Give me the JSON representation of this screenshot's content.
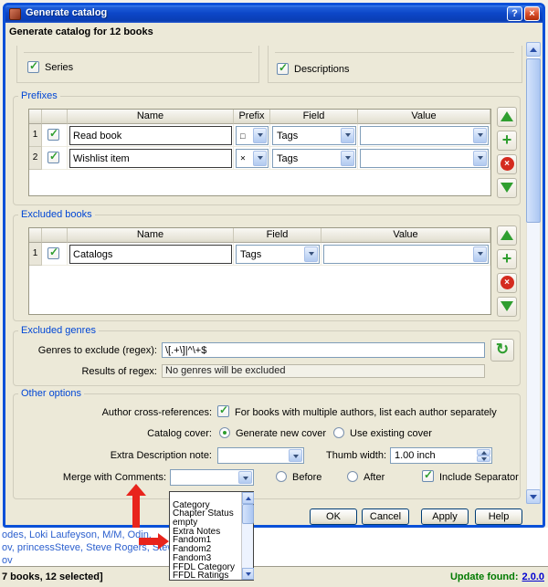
{
  "window": {
    "title": "Generate catalog"
  },
  "icons": {
    "help": "?",
    "close": "×",
    "check": "✓",
    "plus": "+",
    "delete": "×",
    "refresh": "↻"
  },
  "header": {
    "title": "Generate catalog for 12 books"
  },
  "scrolled_top": {
    "series": "Series",
    "descriptions": "Descriptions"
  },
  "prefixes": {
    "title": "Prefixes",
    "headers": {
      "name": "Name",
      "prefix": "Prefix",
      "field": "Field",
      "value": "Value"
    },
    "rows": [
      {
        "num": "1",
        "name": "Read book",
        "prefix": "□",
        "field": "Tags",
        "value": ""
      },
      {
        "num": "2",
        "name": "Wishlist item",
        "prefix": "×",
        "field": "Tags",
        "value": ""
      }
    ]
  },
  "excluded_books": {
    "title": "Excluded books",
    "headers": {
      "name": "Name",
      "field": "Field",
      "value": "Value"
    },
    "rows": [
      {
        "num": "1",
        "name": "Catalogs",
        "field": "Tags",
        "value": ""
      }
    ]
  },
  "excluded_genres": {
    "title": "Excluded genres",
    "regex_label": "Genres to exclude (regex):",
    "regex_value": "\\[.+\\]|^\\+$",
    "results_label": "Results of regex:",
    "results_value": "No genres will be excluded"
  },
  "other_options": {
    "title": "Other options",
    "author_xref_label": "Author cross-references:",
    "author_xref_option": "For books with multiple authors, list each author separately",
    "catalog_cover_label": "Catalog cover:",
    "generate_new_cover": "Generate new cover",
    "use_existing_cover": "Use existing cover",
    "extra_note_label": "Extra Description note:",
    "extra_note_value": "",
    "thumb_width_label": "Thumb width:",
    "thumb_width_value": "1.00 inch",
    "merge_label": "Merge with Comments:",
    "merge_value": "",
    "before": "Before",
    "after": "After",
    "include_separator": "Include Separator"
  },
  "merge_dropdown": {
    "items": [
      "",
      "Category",
      "Chapter Status",
      "empty",
      "Extra Notes",
      "Fandom1",
      "Fandom2",
      "Fandom3",
      "FFDL Category",
      "FFDL Ratings"
    ]
  },
  "dialog_buttons": {
    "ok": "OK",
    "cancel": "Cancel",
    "apply": "Apply",
    "help": "Help"
  },
  "background_window": {
    "tag_lines": [
      "odes, Loki Laufeyson, M/M, Odin,",
      "ov, princessSteve, Steve Rogers, Stew",
      "ov"
    ],
    "status_left": "7 books, 12 selected]",
    "update_label": "Update found:",
    "update_version": "2.0.0"
  },
  "colors": {
    "titlebar_blue": "#0A50D8",
    "group_title_blue": "#0046D5",
    "green_icon": "#2F9E2F",
    "red_icon": "#D42B1E",
    "link_blue": "#2B5FCE",
    "update_green": "#007A00",
    "version_blue": "#0000D0",
    "annotation_red": "#E8241C"
  }
}
